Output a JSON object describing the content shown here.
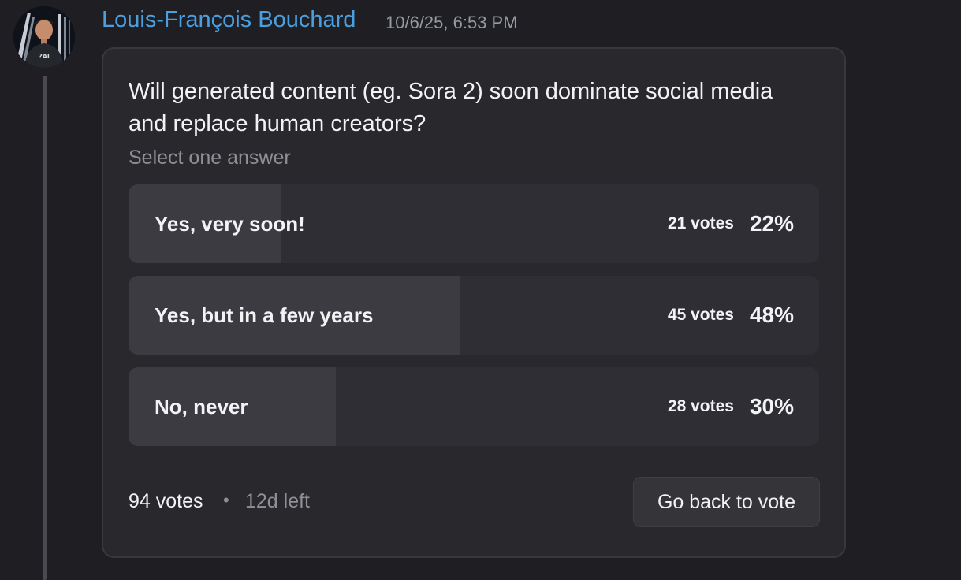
{
  "message": {
    "author": "Louis-François Bouchard",
    "timestamp": "10/6/25, 6:53 PM",
    "avatar_shirt_text": "?AI"
  },
  "poll": {
    "question": "Will generated content (eg. Sora 2) soon dominate social media and replace human creators?",
    "hint": "Select one answer",
    "answers": [
      {
        "label": "Yes, very soon!",
        "votes": "21 votes",
        "percent": "22%",
        "fill_fraction": 0.22
      },
      {
        "label": "Yes, but in a few years",
        "votes": "45 votes",
        "percent": "48%",
        "fill_fraction": 0.48
      },
      {
        "label": "No, never",
        "votes": "28 votes",
        "percent": "30%",
        "fill_fraction": 0.3
      }
    ],
    "total_votes": "94 votes",
    "separator": "•",
    "time_left": "12d left",
    "vote_button": "Go back to vote"
  },
  "colors": {
    "author_name": "#4a9fe0",
    "background": "#1f1f23",
    "card": "#28282d",
    "answer_bar": "#2e2e34",
    "answer_fill": "#3b3b41"
  }
}
